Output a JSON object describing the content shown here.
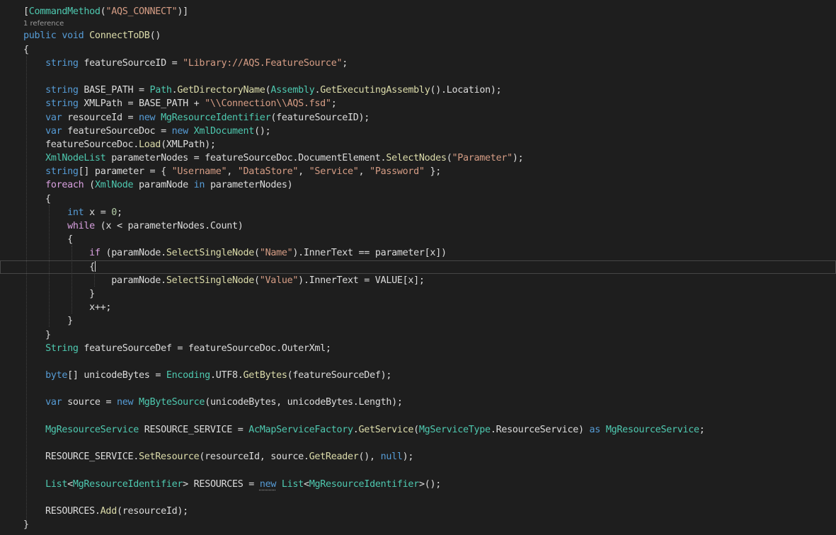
{
  "colors": {
    "background": "#1e1e1e",
    "default_text": "#dcdcdc",
    "keyword": "#569cd6",
    "type": "#4ec9b0",
    "string": "#d69d85",
    "method": "#dcdcaa",
    "number": "#b5cea8",
    "control_keyword": "#d8a0df",
    "codelens": "#999999"
  },
  "codelens": {
    "references": "1 reference"
  },
  "lines": [
    [
      [
        "t",
        "["
      ],
      [
        "ty",
        "CommandMethod"
      ],
      [
        "t",
        "("
      ],
      [
        "str",
        "\"AQS_CONNECT\""
      ],
      [
        "t",
        ")]"
      ]
    ],
    [
      "__CODELENS__"
    ],
    [
      [
        "kw",
        "public"
      ],
      [
        "t",
        " "
      ],
      [
        "kw",
        "void"
      ],
      [
        "t",
        " "
      ],
      [
        "fn",
        "ConnectToDB"
      ],
      [
        "t",
        "()"
      ]
    ],
    [
      [
        "t",
        "{"
      ]
    ],
    [
      [
        "t",
        "    "
      ],
      [
        "kw",
        "string"
      ],
      [
        "t",
        " featureSourceID = "
      ],
      [
        "str",
        "\"Library://AQS.FeatureSource\""
      ],
      [
        "t",
        ";"
      ]
    ],
    [],
    [
      [
        "t",
        "    "
      ],
      [
        "kw",
        "string"
      ],
      [
        "t",
        " BASE_PATH = "
      ],
      [
        "ty",
        "Path"
      ],
      [
        "t",
        "."
      ],
      [
        "fn",
        "GetDirectoryName"
      ],
      [
        "t",
        "("
      ],
      [
        "ty",
        "Assembly"
      ],
      [
        "t",
        "."
      ],
      [
        "fn",
        "GetExecutingAssembly"
      ],
      [
        "t",
        "().Location);"
      ]
    ],
    [
      [
        "t",
        "    "
      ],
      [
        "kw",
        "string"
      ],
      [
        "t",
        " XMLPath = BASE_PATH + "
      ],
      [
        "str",
        "\"\\\\Connection\\\\AQS.fsd\""
      ],
      [
        "t",
        ";"
      ]
    ],
    [
      [
        "t",
        "    "
      ],
      [
        "kw",
        "var"
      ],
      [
        "t",
        " resourceId = "
      ],
      [
        "kw",
        "new"
      ],
      [
        "t",
        " "
      ],
      [
        "ty",
        "MgResourceIdentifier"
      ],
      [
        "t",
        "(featureSourceID);"
      ]
    ],
    [
      [
        "t",
        "    "
      ],
      [
        "kw",
        "var"
      ],
      [
        "t",
        " featureSourceDoc = "
      ],
      [
        "kw",
        "new"
      ],
      [
        "t",
        " "
      ],
      [
        "ty",
        "XmlDocument"
      ],
      [
        "t",
        "();"
      ]
    ],
    [
      [
        "t",
        "    featureSourceDoc."
      ],
      [
        "fn",
        "Load"
      ],
      [
        "t",
        "(XMLPath);"
      ]
    ],
    [
      [
        "t",
        "    "
      ],
      [
        "ty",
        "XmlNodeList"
      ],
      [
        "t",
        " parameterNodes = featureSourceDoc.DocumentElement."
      ],
      [
        "fn",
        "SelectNodes"
      ],
      [
        "t",
        "("
      ],
      [
        "str",
        "\"Parameter\""
      ],
      [
        "t",
        ");"
      ]
    ],
    [
      [
        "t",
        "    "
      ],
      [
        "kw",
        "string"
      ],
      [
        "t",
        "[] parameter = { "
      ],
      [
        "str",
        "\"Username\""
      ],
      [
        "t",
        ", "
      ],
      [
        "str",
        "\"DataStore\""
      ],
      [
        "t",
        ", "
      ],
      [
        "str",
        "\"Service\""
      ],
      [
        "t",
        ", "
      ],
      [
        "str",
        "\"Password\""
      ],
      [
        "t",
        " };"
      ]
    ],
    [
      [
        "t",
        "    "
      ],
      [
        "ctl",
        "foreach"
      ],
      [
        "t",
        " ("
      ],
      [
        "ty",
        "XmlNode"
      ],
      [
        "t",
        " paramNode "
      ],
      [
        "kw",
        "in"
      ],
      [
        "t",
        " parameterNodes)"
      ]
    ],
    [
      [
        "t",
        "    {"
      ]
    ],
    [
      [
        "t",
        "        "
      ],
      [
        "kw",
        "int"
      ],
      [
        "t",
        " x = "
      ],
      [
        "num",
        "0"
      ],
      [
        "t",
        ";"
      ]
    ],
    [
      [
        "t",
        "        "
      ],
      [
        "ctl",
        "while"
      ],
      [
        "t",
        " (x < parameterNodes.Count)"
      ]
    ],
    [
      [
        "t",
        "        {"
      ]
    ],
    [
      [
        "t",
        "            "
      ],
      [
        "ctl",
        "if"
      ],
      [
        "t",
        " (paramNode."
      ],
      [
        "fn",
        "SelectSingleNode"
      ],
      [
        "t",
        "("
      ],
      [
        "str",
        "\"Name\""
      ],
      [
        "t",
        ").InnerText == parameter[x])"
      ]
    ],
    [
      [
        "t",
        "            {"
      ],
      [
        "caret",
        ""
      ]
    ],
    [
      [
        "t",
        "                paramNode."
      ],
      [
        "fn",
        "SelectSingleNode"
      ],
      [
        "t",
        "("
      ],
      [
        "str",
        "\"Value\""
      ],
      [
        "t",
        ").InnerText = VALUE[x];"
      ]
    ],
    [
      [
        "t",
        "            }"
      ]
    ],
    [
      [
        "t",
        "            x++;"
      ]
    ],
    [
      [
        "t",
        "        }"
      ]
    ],
    [
      [
        "t",
        "    }"
      ]
    ],
    [
      [
        "t",
        "    "
      ],
      [
        "ty",
        "String"
      ],
      [
        "t",
        " featureSourceDef = featureSourceDoc.OuterXml;"
      ]
    ],
    [],
    [
      [
        "t",
        "    "
      ],
      [
        "kw",
        "byte"
      ],
      [
        "t",
        "[] unicodeBytes = "
      ],
      [
        "ty",
        "Encoding"
      ],
      [
        "t",
        ".UTF8."
      ],
      [
        "fn",
        "GetBytes"
      ],
      [
        "t",
        "(featureSourceDef);"
      ]
    ],
    [],
    [
      [
        "t",
        "    "
      ],
      [
        "kw",
        "var"
      ],
      [
        "t",
        " source = "
      ],
      [
        "kw",
        "new"
      ],
      [
        "t",
        " "
      ],
      [
        "ty",
        "MgByteSource"
      ],
      [
        "t",
        "(unicodeBytes, unicodeBytes.Length);"
      ]
    ],
    [],
    [
      [
        "t",
        "    "
      ],
      [
        "ty",
        "MgResourceService"
      ],
      [
        "t",
        " RESOURCE_SERVICE = "
      ],
      [
        "ty",
        "AcMapServiceFactory"
      ],
      [
        "t",
        "."
      ],
      [
        "fn",
        "GetService"
      ],
      [
        "t",
        "("
      ],
      [
        "ty",
        "MgServiceType"
      ],
      [
        "t",
        ".ResourceService) "
      ],
      [
        "kw",
        "as"
      ],
      [
        "t",
        " "
      ],
      [
        "ty",
        "MgResourceService"
      ],
      [
        "t",
        ";"
      ]
    ],
    [],
    [
      [
        "t",
        "    RESOURCE_SERVICE."
      ],
      [
        "fn",
        "SetResource"
      ],
      [
        "t",
        "(resourceId, source."
      ],
      [
        "fn",
        "GetReader"
      ],
      [
        "t",
        "(), "
      ],
      [
        "kw",
        "null"
      ],
      [
        "t",
        ");"
      ]
    ],
    [],
    [
      [
        "t",
        "    "
      ],
      [
        "ty",
        "List"
      ],
      [
        "t",
        "<"
      ],
      [
        "ty",
        "MgResourceIdentifier"
      ],
      [
        "t",
        "> RESOURCES = "
      ],
      [
        "kwsq",
        "new"
      ],
      [
        "t",
        " "
      ],
      [
        "ty",
        "List"
      ],
      [
        "t",
        "<"
      ],
      [
        "ty",
        "MgResourceIdentifier"
      ],
      [
        "t",
        ">();"
      ]
    ],
    [],
    [
      [
        "t",
        "    RESOURCES."
      ],
      [
        "fn",
        "Add"
      ],
      [
        "t",
        "(resourceId);"
      ]
    ],
    [
      [
        "t",
        "}"
      ]
    ]
  ]
}
